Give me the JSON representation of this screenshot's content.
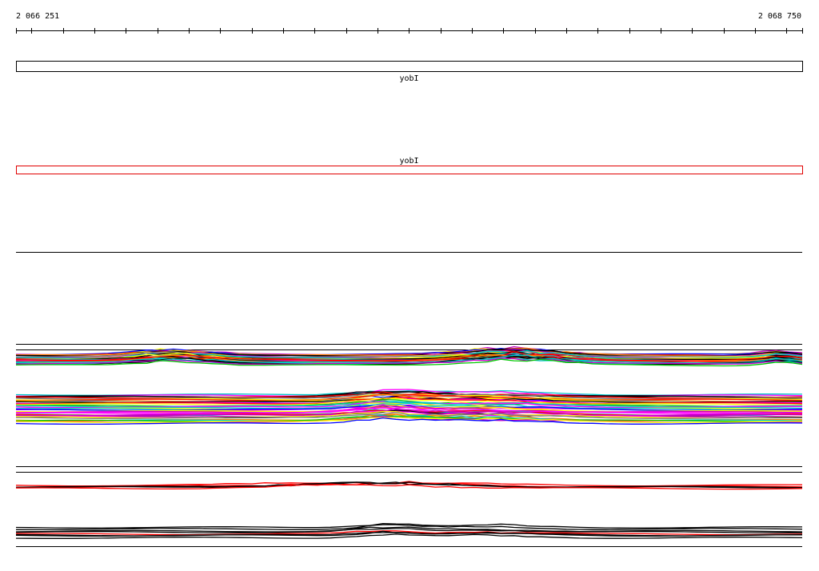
{
  "genome_browser": {
    "coord_start": "2 066 251",
    "coord_end": "2 068 750"
  },
  "chart_data": {
    "type": "line",
    "x_range": [
      2066251,
      2068750
    ],
    "tick_step": 100,
    "features": [
      {
        "label": "yobI",
        "start": 2066251,
        "end": 2068750,
        "strand": "+",
        "color": "#000000"
      },
      {
        "label": "yobI",
        "start": 2066251,
        "end": 2068750,
        "strand": "-",
        "color": "#e00000"
      }
    ],
    "track_groups": [
      {
        "name": "",
        "palette": [
          "#000000",
          "#00c8c8",
          "#ff00ff",
          "#0000ff",
          "#00c800",
          "#c800c8",
          "#ff0000",
          "#ffff00",
          "#808080",
          "#ff8000"
        ]
      },
      {
        "name": "",
        "palette": [
          "#000000",
          "#ff0000"
        ]
      }
    ]
  }
}
